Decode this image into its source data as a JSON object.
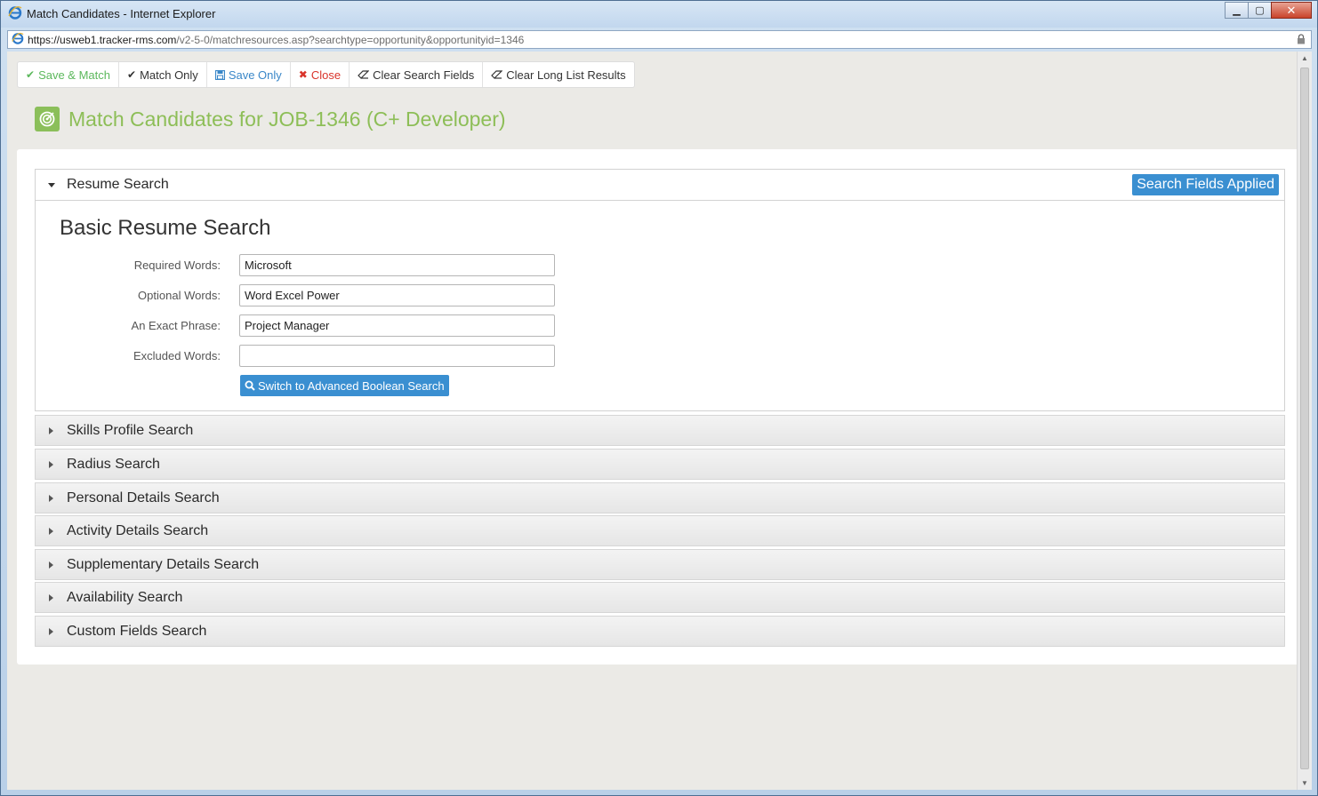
{
  "window": {
    "title": "Match Candidates - Internet Explorer",
    "controls": {
      "minimize": "▁",
      "maximize": "▢",
      "close": "✕"
    }
  },
  "address": {
    "scheme": "https://",
    "domain": "usweb1.tracker-rms.com",
    "path": "/v2-5-0/matchresources.asp?searchtype=opportunity&opportunityid=1346"
  },
  "toolbar": {
    "save_match": "Save & Match",
    "match_only": "Match Only",
    "save_only": "Save Only",
    "close": "Close",
    "clear_fields": "Clear Search Fields",
    "clear_long_list": "Clear Long List Results"
  },
  "page": {
    "title": "Match Candidates for JOB-1346 (C+ Developer)"
  },
  "resume_search": {
    "header": "Resume Search",
    "badge": "Search Fields Applied",
    "subtitle": "Basic Resume Search",
    "fields": [
      {
        "label": "Required Words:",
        "value": "Microsoft"
      },
      {
        "label": "Optional Words:",
        "value": "Word Excel Power"
      },
      {
        "label": "An Exact Phrase:",
        "value": "Project Manager"
      },
      {
        "label": "Excluded Words:",
        "value": ""
      }
    ],
    "switch_button": "Switch to Advanced Boolean Search"
  },
  "sections": [
    {
      "label": "Skills Profile Search"
    },
    {
      "label": "Radius Search"
    },
    {
      "label": "Personal Details Search"
    },
    {
      "label": "Activity Details Search"
    },
    {
      "label": "Supplementary Details Search"
    },
    {
      "label": "Availability Search"
    },
    {
      "label": "Custom Fields Search"
    }
  ],
  "colors": {
    "accent_green": "#8dbe57",
    "accent_blue": "#3a8fd1",
    "close_red": "#d9342b"
  }
}
